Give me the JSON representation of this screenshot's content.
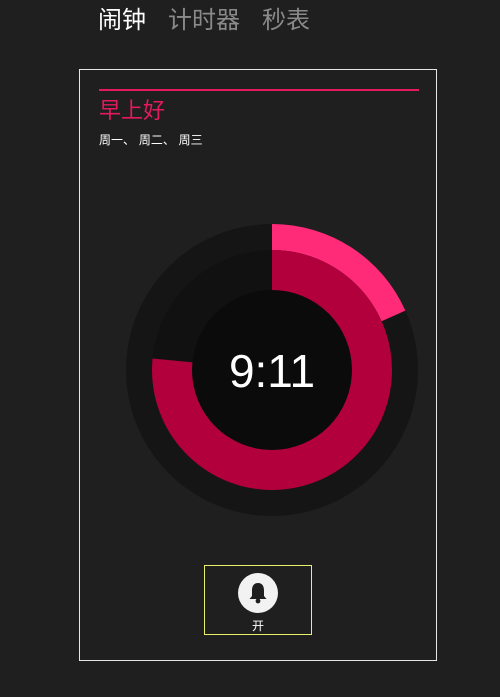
{
  "tabs": [
    {
      "label": "闹钟",
      "active": true
    },
    {
      "label": "计时器",
      "active": false
    },
    {
      "label": "秒表",
      "active": false
    }
  ],
  "alarm": {
    "title": "早上好",
    "days": "周一、 周二、 周三",
    "time": "9:11",
    "hour": 9,
    "minute": 11,
    "toggle_label": "开",
    "toggle_icon": "bell-icon"
  },
  "colors": {
    "accent": "#e5195d",
    "hour_ring": "#b2003c",
    "minute_ring": "#ff2a78",
    "border": "#ffffff",
    "button_border": "#e6f06b"
  }
}
